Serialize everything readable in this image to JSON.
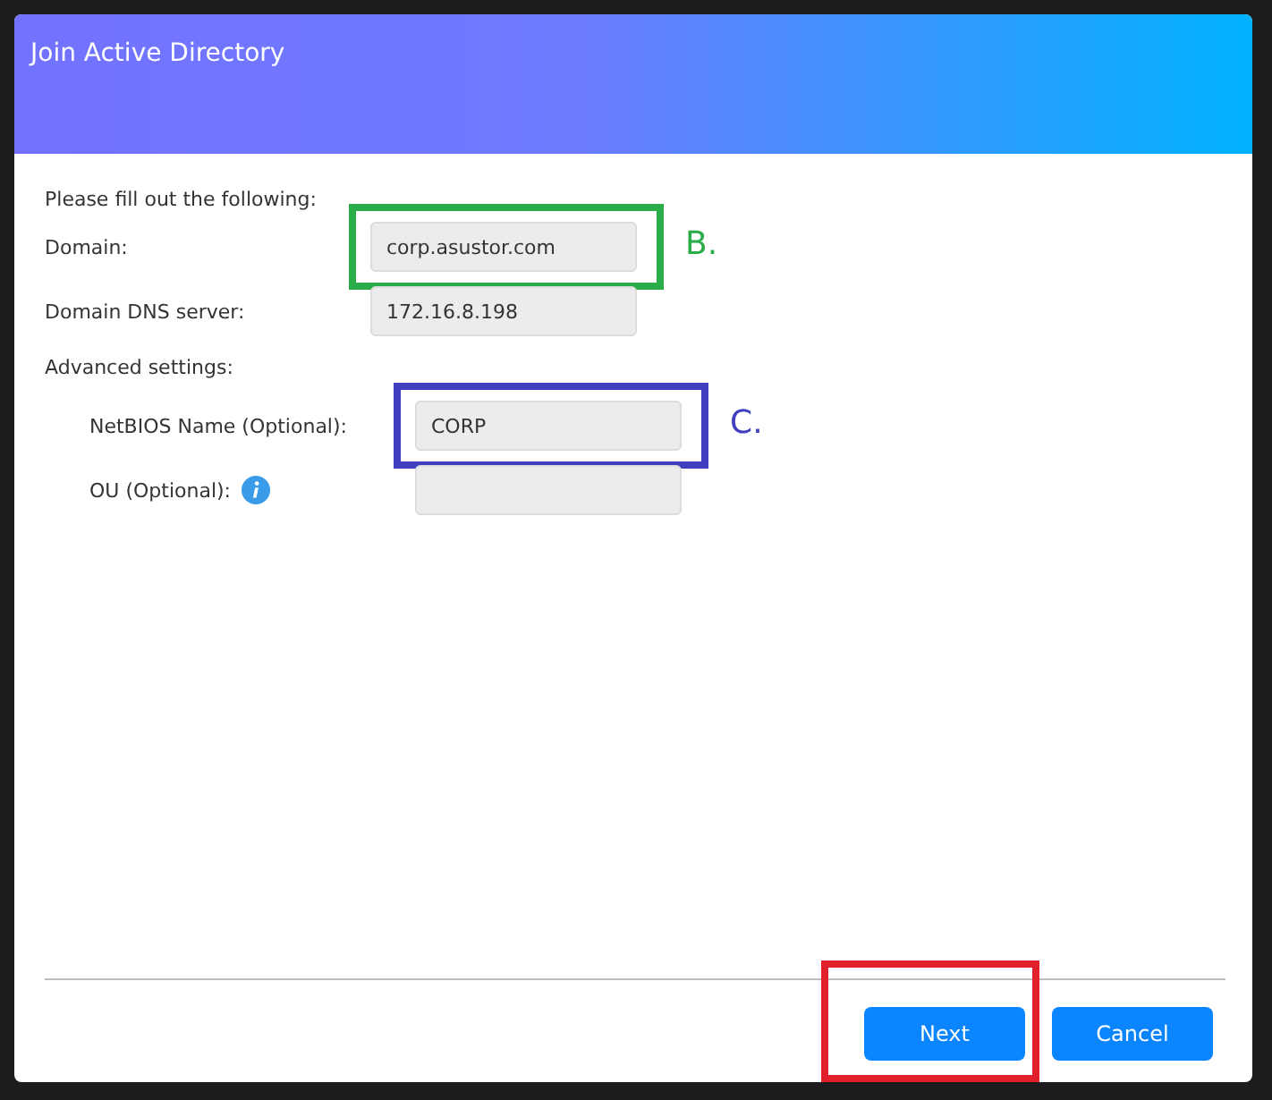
{
  "window": {
    "title": "Join Active Directory"
  },
  "intro": "Please fill out the following:",
  "fields": [
    {
      "label": "Domain:",
      "value": "corp.asustor.com",
      "annotation": {
        "label": "B.",
        "color": "#2aad48"
      }
    },
    {
      "label": "Domain DNS server:",
      "value": "172.16.8.198"
    }
  ],
  "advanced": {
    "label": "Advanced settings:",
    "fields": [
      {
        "label": "NetBIOS Name (Optional):",
        "value": "CORP",
        "annotation": {
          "label": "C.",
          "color": "#3f3fc0"
        }
      },
      {
        "label": "OU (Optional):",
        "info": true
      }
    ]
  },
  "buttons": [
    {
      "label": "Next",
      "annotation": {
        "color": "#e0202c"
      }
    },
    {
      "label": "Cancel"
    }
  ]
}
